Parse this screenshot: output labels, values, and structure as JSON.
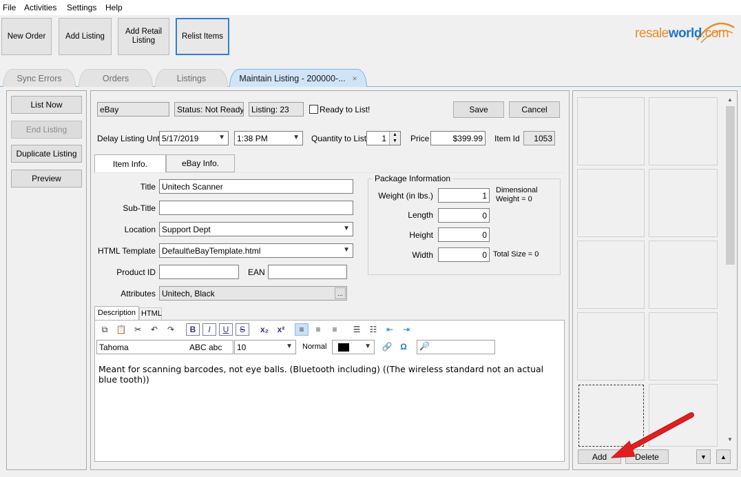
{
  "menu": [
    "File",
    "Activities",
    "Settings",
    "Help"
  ],
  "toolbar": {
    "new_order": "New Order",
    "add_listing": "Add Listing",
    "add_retail_listing": "Add Retail\nListing",
    "relist_items": "Relist Items"
  },
  "logo": {
    "part1": "resale",
    "part2": "world",
    "part3": ".com"
  },
  "tabs": [
    {
      "label": "Sync Errors"
    },
    {
      "label": "Orders"
    },
    {
      "label": "Listings"
    },
    {
      "label": "Maintain Listing - 200000-...",
      "close": "×"
    }
  ],
  "side_actions": {
    "list_now": "List Now",
    "end_listing": "End Listing",
    "duplicate_listing": "Duplicate Listing",
    "preview": "Preview"
  },
  "listing": {
    "channel": "eBay",
    "status": "Status: Not Ready",
    "listing_no": "Listing: 23",
    "ready_label": "Ready to List!",
    "save": "Save",
    "cancel": "Cancel",
    "delay_label": "Delay Listing Until",
    "delay_date": "5/17/2019",
    "delay_time": "1:38 PM",
    "qty_label": "Quantity to List",
    "qty_value": "1",
    "price_label": "Price",
    "price_value": "$399.99",
    "item_id_label": "Item Id",
    "item_id_value": "1053"
  },
  "inner_tabs": {
    "item_info": "Item Info.",
    "ebay_info": "eBay Info."
  },
  "item_info": {
    "title_label": "Title",
    "title_value": "Unitech Scanner",
    "subtitle_label": "Sub-Title",
    "subtitle_value": "",
    "location_label": "Location",
    "location_value": "Support Dept",
    "template_label": "HTML Template",
    "template_value": "Default\\eBayTemplate.html",
    "product_id_label": "Product ID",
    "product_id_value": "",
    "ean_label": "EAN",
    "ean_value": "",
    "attributes_label": "Attributes",
    "attributes_value": "Unitech, Black",
    "attributes_btn": "..."
  },
  "package": {
    "title": "Package Information",
    "weight_label": "Weight (in lbs.)",
    "weight_value": "1",
    "dim_weight": "Dimensional\nWeight = 0",
    "length_label": "Length",
    "length_value": "0",
    "height_label": "Height",
    "height_value": "0",
    "width_label": "Width",
    "width_value": "0",
    "total_size": "Total Size = 0"
  },
  "editor": {
    "tab_description": "Description",
    "tab_html": "HTML",
    "font_name": "Tahoma",
    "font_sample": "ABC abc",
    "font_size": "10",
    "paragraph_style": "Normal",
    "text_color": "#000000",
    "content": "Meant for scanning barcodes, not eye balls. (Bluetooth including) ((The wireless standard not an actual blue tooth))"
  },
  "photos": {
    "add": "Add",
    "delete": "Delete"
  },
  "colors": {
    "accent": "#2f7fcf",
    "tab_active": "#cfe4f7",
    "arrow": "#e02020"
  }
}
